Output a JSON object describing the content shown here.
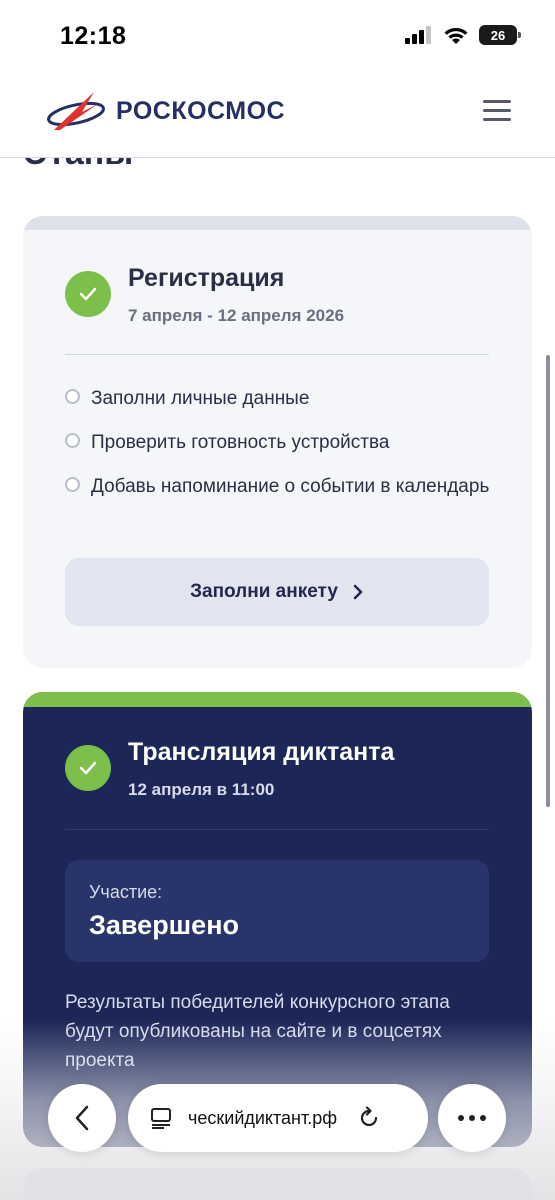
{
  "status_bar": {
    "time": "12:18",
    "battery_level": "26"
  },
  "header": {
    "logo_text": "РОСКОСМОС"
  },
  "page": {
    "section_title": "Этапы"
  },
  "stage_registration": {
    "title": "Регистрация",
    "dates": "7 апреля - 12 апреля 2026",
    "completed": true,
    "tasks": [
      {
        "label": "Заполни личные данные"
      },
      {
        "label": "Проверить готовность устройства"
      },
      {
        "label": "Добавь напоминание о событии в календарь"
      }
    ],
    "button_label": "Заполни анкету"
  },
  "stage_broadcast": {
    "title": "Трансляция диктанта",
    "date": "12 апреля в 11:00",
    "completed": true,
    "participation_caption": "Участие:",
    "participation_status": "Завершено",
    "results_text": "Результаты победителей конкурсного этапа будут опубликованы на сайте и в соцсетях проекта"
  },
  "browser": {
    "url": "ческийдиктант.рф"
  },
  "colors": {
    "brand_navy": "#1c2758",
    "accent_green": "#7cc04b",
    "logo_red": "#e0332e",
    "card_light": "#f5f6f9"
  }
}
